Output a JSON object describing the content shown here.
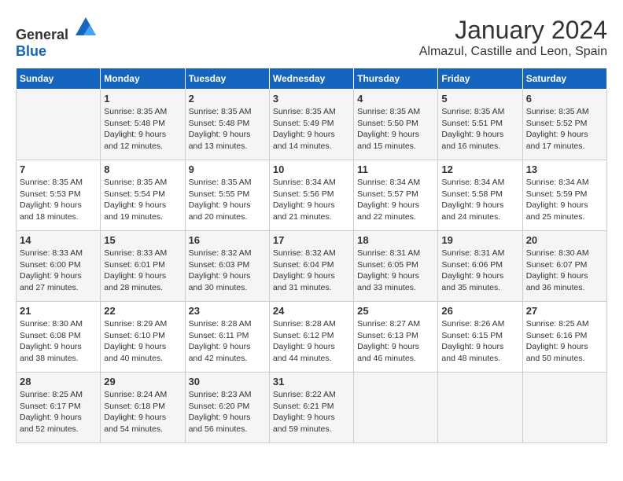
{
  "header": {
    "logo": {
      "text_general": "General",
      "text_blue": "Blue"
    },
    "month": "January 2024",
    "location": "Almazul, Castille and Leon, Spain"
  },
  "weekdays": [
    "Sunday",
    "Monday",
    "Tuesday",
    "Wednesday",
    "Thursday",
    "Friday",
    "Saturday"
  ],
  "weeks": [
    [
      {
        "day": "",
        "info": ""
      },
      {
        "day": "1",
        "info": "Sunrise: 8:35 AM\nSunset: 5:48 PM\nDaylight: 9 hours\nand 12 minutes."
      },
      {
        "day": "2",
        "info": "Sunrise: 8:35 AM\nSunset: 5:48 PM\nDaylight: 9 hours\nand 13 minutes."
      },
      {
        "day": "3",
        "info": "Sunrise: 8:35 AM\nSunset: 5:49 PM\nDaylight: 9 hours\nand 14 minutes."
      },
      {
        "day": "4",
        "info": "Sunrise: 8:35 AM\nSunset: 5:50 PM\nDaylight: 9 hours\nand 15 minutes."
      },
      {
        "day": "5",
        "info": "Sunrise: 8:35 AM\nSunset: 5:51 PM\nDaylight: 9 hours\nand 16 minutes."
      },
      {
        "day": "6",
        "info": "Sunrise: 8:35 AM\nSunset: 5:52 PM\nDaylight: 9 hours\nand 17 minutes."
      }
    ],
    [
      {
        "day": "7",
        "info": "Sunrise: 8:35 AM\nSunset: 5:53 PM\nDaylight: 9 hours\nand 18 minutes."
      },
      {
        "day": "8",
        "info": "Sunrise: 8:35 AM\nSunset: 5:54 PM\nDaylight: 9 hours\nand 19 minutes."
      },
      {
        "day": "9",
        "info": "Sunrise: 8:35 AM\nSunset: 5:55 PM\nDaylight: 9 hours\nand 20 minutes."
      },
      {
        "day": "10",
        "info": "Sunrise: 8:34 AM\nSunset: 5:56 PM\nDaylight: 9 hours\nand 21 minutes."
      },
      {
        "day": "11",
        "info": "Sunrise: 8:34 AM\nSunset: 5:57 PM\nDaylight: 9 hours\nand 22 minutes."
      },
      {
        "day": "12",
        "info": "Sunrise: 8:34 AM\nSunset: 5:58 PM\nDaylight: 9 hours\nand 24 minutes."
      },
      {
        "day": "13",
        "info": "Sunrise: 8:34 AM\nSunset: 5:59 PM\nDaylight: 9 hours\nand 25 minutes."
      }
    ],
    [
      {
        "day": "14",
        "info": "Sunrise: 8:33 AM\nSunset: 6:00 PM\nDaylight: 9 hours\nand 27 minutes."
      },
      {
        "day": "15",
        "info": "Sunrise: 8:33 AM\nSunset: 6:01 PM\nDaylight: 9 hours\nand 28 minutes."
      },
      {
        "day": "16",
        "info": "Sunrise: 8:32 AM\nSunset: 6:03 PM\nDaylight: 9 hours\nand 30 minutes."
      },
      {
        "day": "17",
        "info": "Sunrise: 8:32 AM\nSunset: 6:04 PM\nDaylight: 9 hours\nand 31 minutes."
      },
      {
        "day": "18",
        "info": "Sunrise: 8:31 AM\nSunset: 6:05 PM\nDaylight: 9 hours\nand 33 minutes."
      },
      {
        "day": "19",
        "info": "Sunrise: 8:31 AM\nSunset: 6:06 PM\nDaylight: 9 hours\nand 35 minutes."
      },
      {
        "day": "20",
        "info": "Sunrise: 8:30 AM\nSunset: 6:07 PM\nDaylight: 9 hours\nand 36 minutes."
      }
    ],
    [
      {
        "day": "21",
        "info": "Sunrise: 8:30 AM\nSunset: 6:08 PM\nDaylight: 9 hours\nand 38 minutes."
      },
      {
        "day": "22",
        "info": "Sunrise: 8:29 AM\nSunset: 6:10 PM\nDaylight: 9 hours\nand 40 minutes."
      },
      {
        "day": "23",
        "info": "Sunrise: 8:28 AM\nSunset: 6:11 PM\nDaylight: 9 hours\nand 42 minutes."
      },
      {
        "day": "24",
        "info": "Sunrise: 8:28 AM\nSunset: 6:12 PM\nDaylight: 9 hours\nand 44 minutes."
      },
      {
        "day": "25",
        "info": "Sunrise: 8:27 AM\nSunset: 6:13 PM\nDaylight: 9 hours\nand 46 minutes."
      },
      {
        "day": "26",
        "info": "Sunrise: 8:26 AM\nSunset: 6:15 PM\nDaylight: 9 hours\nand 48 minutes."
      },
      {
        "day": "27",
        "info": "Sunrise: 8:25 AM\nSunset: 6:16 PM\nDaylight: 9 hours\nand 50 minutes."
      }
    ],
    [
      {
        "day": "28",
        "info": "Sunrise: 8:25 AM\nSunset: 6:17 PM\nDaylight: 9 hours\nand 52 minutes."
      },
      {
        "day": "29",
        "info": "Sunrise: 8:24 AM\nSunset: 6:18 PM\nDaylight: 9 hours\nand 54 minutes."
      },
      {
        "day": "30",
        "info": "Sunrise: 8:23 AM\nSunset: 6:20 PM\nDaylight: 9 hours\nand 56 minutes."
      },
      {
        "day": "31",
        "info": "Sunrise: 8:22 AM\nSunset: 6:21 PM\nDaylight: 9 hours\nand 59 minutes."
      },
      {
        "day": "",
        "info": ""
      },
      {
        "day": "",
        "info": ""
      },
      {
        "day": "",
        "info": ""
      }
    ]
  ]
}
